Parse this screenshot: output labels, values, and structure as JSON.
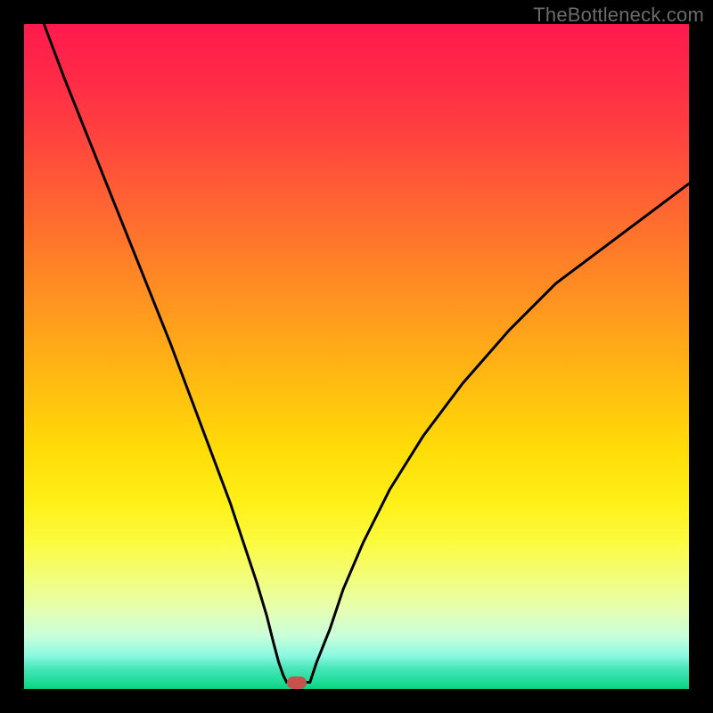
{
  "watermark": {
    "text": "TheBottleneck.com"
  },
  "chart_data": {
    "type": "line",
    "title": "",
    "xlabel": "",
    "ylabel": "",
    "xlim": [
      0,
      100
    ],
    "ylim": [
      0,
      100
    ],
    "grid": false,
    "legend": false,
    "background": "rainbow-gradient-vertical",
    "series": [
      {
        "name": "left-curve",
        "x": [
          3,
          6,
          10,
          14,
          18,
          22,
          25,
          28,
          31,
          33,
          35,
          36.5,
          37.5,
          38.3,
          39,
          39.5
        ],
        "y": [
          100,
          92,
          82,
          72,
          62,
          52,
          44,
          36,
          28,
          22,
          16,
          11,
          7,
          4,
          2,
          1
        ]
      },
      {
        "name": "right-curve",
        "x": [
          43,
          44,
          46,
          48,
          51,
          55,
          60,
          66,
          73,
          80,
          88,
          96,
          100
        ],
        "y": [
          1,
          4,
          9,
          15,
          22,
          30,
          38,
          46,
          54,
          61,
          67,
          73,
          76
        ]
      },
      {
        "name": "trough-flat",
        "x": [
          39.5,
          43
        ],
        "y": [
          1,
          1
        ]
      }
    ],
    "marker": {
      "x": 41,
      "y": 1,
      "color": "#c6524c"
    },
    "curve_stroke": "#000000",
    "curve_stroke_width": 3
  }
}
